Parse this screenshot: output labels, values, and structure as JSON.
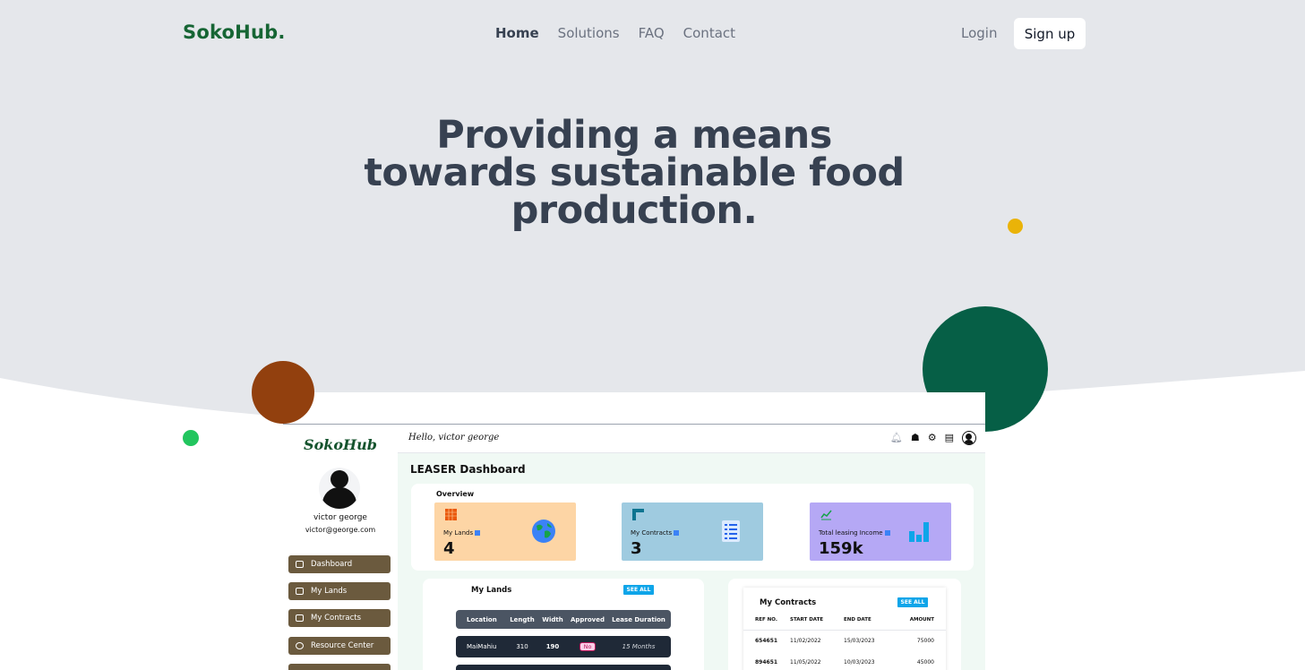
{
  "nav": {
    "logo": "SokoHub.",
    "links": [
      "Home",
      "Solutions",
      "FAQ",
      "Contact"
    ],
    "login": "Login",
    "signup": "Sign up"
  },
  "hero": {
    "line1": "Providing a means",
    "line2": "towards sustainable food",
    "line3": "production."
  },
  "colors": {
    "brand_green": "#166534",
    "hero_text": "#374151",
    "accent_yellow": "#eab308",
    "accent_brown": "#92400e",
    "accent_green": "#065f46",
    "sidebar_button": "#6b5a3e"
  },
  "dashboard": {
    "sidebar": {
      "logo": "SokoHub",
      "user_name": "victor george",
      "user_email": "victor@george.com",
      "items": [
        {
          "label": "Dashboard",
          "icon": "home-icon"
        },
        {
          "label": "My Lands",
          "icon": "land-icon"
        },
        {
          "label": "My Contracts",
          "icon": "contract-icon"
        },
        {
          "label": "Resource Center",
          "icon": "resource-icon"
        }
      ]
    },
    "topbar": {
      "greeting": "Hello, victor george",
      "icons": [
        "bell-icon",
        "gift-icon",
        "settings-icon",
        "chat-icon",
        "user-avatar-icon"
      ]
    },
    "title": "LEASER Dashboard",
    "overview": {
      "title": "Overview",
      "cards": [
        {
          "label": "My Lands",
          "value": "4",
          "color": "#fdd5a5",
          "icon": "globe-icon"
        },
        {
          "label": "My Contracts",
          "value": "3",
          "color": "#9fcbe0",
          "icon": "list-icon"
        },
        {
          "label": "Total leasing Income",
          "value": "159k",
          "color": "#b5a8f5",
          "icon": "bar-chart-icon"
        }
      ]
    },
    "lands": {
      "title": "My Lands",
      "see_all": "SEE ALL",
      "columns": [
        "Location",
        "Length",
        "Width",
        "Approved",
        "Lease Duration"
      ],
      "rows": [
        {
          "location": "MaiMahiu",
          "length": "310",
          "width": "190",
          "approved": "No",
          "duration": "15 Months"
        }
      ]
    },
    "contracts": {
      "title": "My Contracts",
      "see_all": "SEE ALL",
      "columns": [
        "REF NO.",
        "START DATE",
        "END DATE",
        "AMOUNT"
      ],
      "rows": [
        {
          "ref": "654651",
          "start": "11/02/2022",
          "end": "15/03/2023",
          "amount": "75000"
        },
        {
          "ref": "894651",
          "start": "11/05/2022",
          "end": "10/03/2023",
          "amount": "45000"
        }
      ]
    }
  }
}
